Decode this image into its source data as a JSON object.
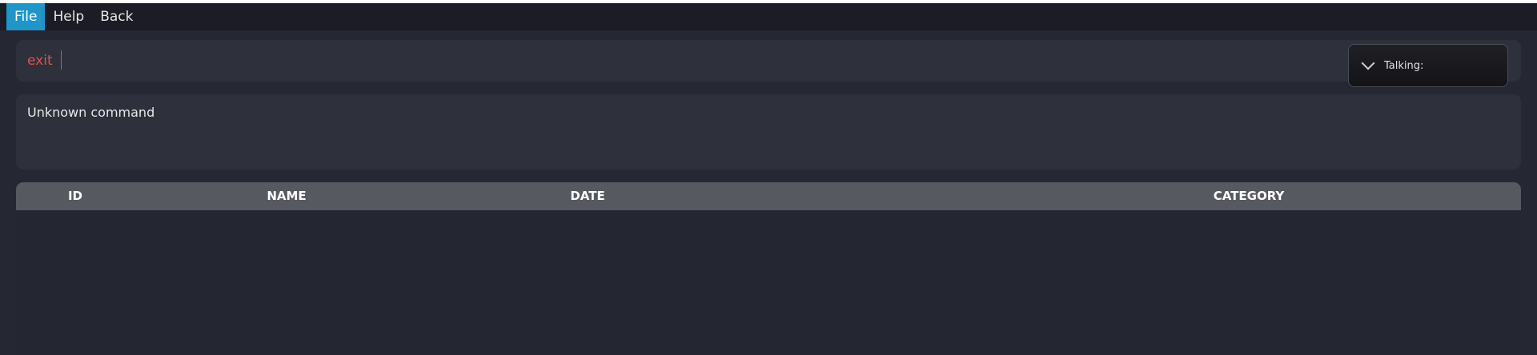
{
  "menubar": {
    "items": [
      {
        "label": "File",
        "active": true
      },
      {
        "label": "Help",
        "active": false
      },
      {
        "label": "Back",
        "active": false
      }
    ]
  },
  "command": {
    "value": "exit"
  },
  "talking": {
    "label": "Talking:",
    "icon": "chevron-down-icon"
  },
  "result": {
    "text": "Unknown command"
  },
  "table": {
    "columns": [
      "ID",
      "NAME",
      "DATE",
      "CATEGORY"
    ],
    "rows": []
  },
  "colors": {
    "accent": "#1f95c8",
    "command_text": "#d9534f",
    "background": "#252733",
    "panel": "#2e303b",
    "table_header": "#575961"
  }
}
